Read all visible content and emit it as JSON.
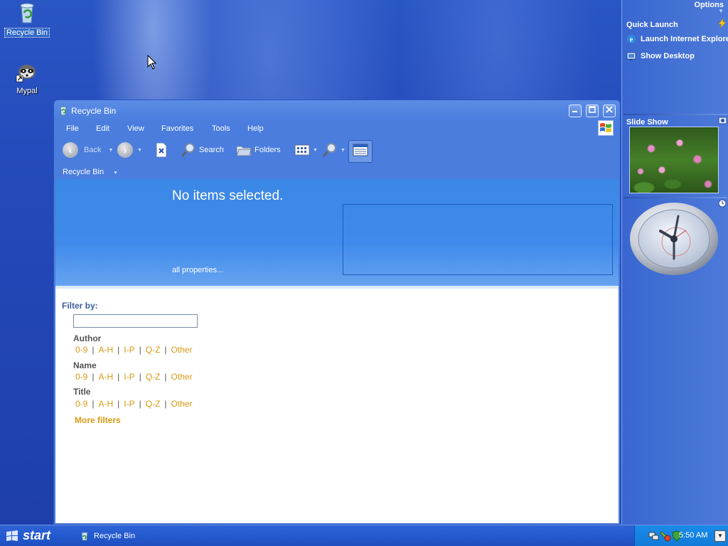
{
  "desktop": {
    "icons": [
      {
        "label": "Recycle Bin"
      },
      {
        "label": "Mypal"
      }
    ]
  },
  "sidebar": {
    "options_label": "Options",
    "quick_launch_title": "Quick Launch",
    "quick_launch_items": [
      {
        "label": "Launch Internet Explorer",
        "icon": "ie-icon"
      },
      {
        "label": "Show Desktop",
        "icon": "desktop-icon"
      }
    ],
    "slideshow_title": "Slide Show"
  },
  "window": {
    "title": "Recycle Bin",
    "menu": [
      "File",
      "Edit",
      "View",
      "Favorites",
      "Tools",
      "Help"
    ],
    "toolbar": {
      "back_label": "Back",
      "search_label": "Search",
      "folders_label": "Folders"
    },
    "address": "Recycle Bin",
    "details": {
      "status": "No items selected.",
      "all_properties": "all properties..."
    },
    "filter": {
      "label": "Filter by:",
      "input_value": "",
      "facets": [
        {
          "title": "Author",
          "links": [
            "0-9",
            "A-H",
            "I-P",
            "Q-Z",
            "Other"
          ]
        },
        {
          "title": "Name",
          "links": [
            "0-9",
            "A-H",
            "I-P",
            "Q-Z",
            "Other"
          ]
        },
        {
          "title": "Title",
          "links": [
            "0-9",
            "A-H",
            "I-P",
            "Q-Z",
            "Other"
          ]
        }
      ],
      "more": "More filters"
    }
  },
  "taskbar": {
    "start_label": "start",
    "task_label": "Recycle Bin",
    "clock": "5:50 AM"
  },
  "colors": {
    "desktop_blue": "#2348b8",
    "window_blue": "#4a7ddd",
    "link_orange": "#d89a14",
    "tray_blue": "#127bd9"
  }
}
